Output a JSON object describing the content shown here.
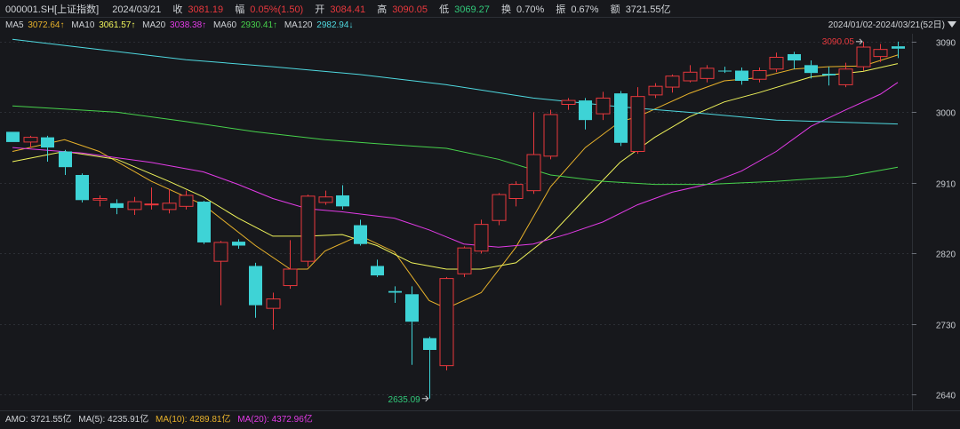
{
  "quote": {
    "symbol": "000001.SH[上证指数]",
    "date": "2024/03/21",
    "close_label": "收",
    "close": "3081.19",
    "change_label": "幅",
    "change": "0.05%(1.50)",
    "open_label": "开",
    "open": "3084.41",
    "high_label": "高",
    "high": "3090.05",
    "low_label": "低",
    "low": "3069.27",
    "turnover_label": "换",
    "turnover": "0.70%",
    "amplitude_label": "振",
    "amplitude": "0.67%",
    "amount_label": "额",
    "amount": "3721.55亿"
  },
  "ma_bar": [
    {
      "label": "MA5",
      "value": "3072.64↑",
      "color": "#e8b22b"
    },
    {
      "label": "MA10",
      "value": "3061.57↑",
      "color": "#eef25a"
    },
    {
      "label": "MA20",
      "value": "3038.38↑",
      "color": "#e23be6"
    },
    {
      "label": "MA60",
      "value": "2930.41↑",
      "color": "#47d24c"
    },
    {
      "label": "MA120",
      "value": "2982.94↓",
      "color": "#4fd9e0"
    }
  ],
  "range_label": "2024/01/02-2024/03/21(52日)",
  "range_icon": "triangle-down-icon",
  "annotations": {
    "high": "3090.05",
    "low": "2635.09"
  },
  "amo_bar": {
    "label": "AMO: ",
    "value": "3721.55亿",
    "items": [
      {
        "text": "MA(5): 4235.91亿",
        "color": "#cfd2d6"
      },
      {
        "text": "MA(10): 4289.81亿",
        "color": "#e8b22b"
      },
      {
        "text": "MA(20): 4372.96亿",
        "color": "#e23be6"
      }
    ]
  },
  "colors": {
    "up": "#e8383d",
    "down": "#3ed3d6",
    "grid": "#2c2f35",
    "text": "#c8cbd0",
    "bg": "#17181c"
  },
  "chart_data": {
    "type": "candlestick",
    "ylim": [
      2620,
      3100
    ],
    "yticks": [
      3090,
      3000,
      2910,
      2820,
      2730,
      2640
    ],
    "candles": [
      {
        "o": 2975,
        "c": 2962,
        "h": 2975,
        "l": 2962
      },
      {
        "o": 2962,
        "c": 2968,
        "h": 2970,
        "l": 2955
      },
      {
        "o": 2968,
        "c": 2955,
        "h": 2970,
        "l": 2937
      },
      {
        "o": 2950,
        "c": 2930,
        "h": 2952,
        "l": 2920
      },
      {
        "o": 2920,
        "c": 2888,
        "h": 2922,
        "l": 2885
      },
      {
        "o": 2888,
        "c": 2890,
        "h": 2894,
        "l": 2880
      },
      {
        "o": 2884,
        "c": 2878,
        "h": 2889,
        "l": 2870
      },
      {
        "o": 2876,
        "c": 2886,
        "h": 2892,
        "l": 2869
      },
      {
        "o": 2882,
        "c": 2883,
        "h": 2904,
        "l": 2876
      },
      {
        "o": 2876,
        "c": 2884,
        "h": 2902,
        "l": 2871
      },
      {
        "o": 2880,
        "c": 2894,
        "h": 2900,
        "l": 2876
      },
      {
        "o": 2886,
        "c": 2834,
        "h": 2887,
        "l": 2832
      },
      {
        "o": 2810,
        "c": 2834,
        "h": 2836,
        "l": 2754
      },
      {
        "o": 2835,
        "c": 2830,
        "h": 2838,
        "l": 2826
      },
      {
        "o": 2804,
        "c": 2754,
        "h": 2808,
        "l": 2738
      },
      {
        "o": 2750,
        "c": 2762,
        "h": 2770,
        "l": 2723
      },
      {
        "o": 2779,
        "c": 2800,
        "h": 2837,
        "l": 2775
      },
      {
        "o": 2810,
        "c": 2893,
        "h": 2895,
        "l": 2803
      },
      {
        "o": 2885,
        "c": 2892,
        "h": 2900,
        "l": 2882
      },
      {
        "o": 2894,
        "c": 2880,
        "h": 2907,
        "l": 2876
      },
      {
        "o": 2856,
        "c": 2832,
        "h": 2863,
        "l": 2830
      },
      {
        "o": 2804,
        "c": 2792,
        "h": 2812,
        "l": 2790
      },
      {
        "o": 2772,
        "c": 2770,
        "h": 2778,
        "l": 2757
      },
      {
        "o": 2768,
        "c": 2733,
        "h": 2778,
        "l": 2678
      },
      {
        "o": 2712,
        "c": 2697,
        "h": 2714,
        "l": 2635
      },
      {
        "o": 2677,
        "c": 2788,
        "h": 2790,
        "l": 2671
      },
      {
        "o": 2794,
        "c": 2827,
        "h": 2829,
        "l": 2790
      },
      {
        "o": 2823,
        "c": 2857,
        "h": 2863,
        "l": 2820
      },
      {
        "o": 2862,
        "c": 2895,
        "h": 2897,
        "l": 2856
      },
      {
        "o": 2890,
        "c": 2908,
        "h": 2912,
        "l": 2880
      },
      {
        "o": 2900,
        "c": 2946,
        "h": 3000,
        "l": 2896
      },
      {
        "o": 2944,
        "c": 2997,
        "h": 3003,
        "l": 2940
      },
      {
        "o": 3010,
        "c": 3015,
        "h": 3018,
        "l": 3003
      },
      {
        "o": 3015,
        "c": 2990,
        "h": 3018,
        "l": 2978
      },
      {
        "o": 2998,
        "c": 3018,
        "h": 3026,
        "l": 2990
      },
      {
        "o": 3024,
        "c": 2961,
        "h": 3027,
        "l": 2957
      },
      {
        "o": 2950,
        "c": 3020,
        "h": 3032,
        "l": 2947
      },
      {
        "o": 3022,
        "c": 3033,
        "h": 3037,
        "l": 3018
      },
      {
        "o": 3032,
        "c": 3046,
        "h": 3048,
        "l": 3025
      },
      {
        "o": 3040,
        "c": 3051,
        "h": 3060,
        "l": 3038
      },
      {
        "o": 3043,
        "c": 3056,
        "h": 3060,
        "l": 3038
      },
      {
        "o": 3053,
        "c": 3052,
        "h": 3058,
        "l": 3050
      },
      {
        "o": 3053,
        "c": 3040,
        "h": 3057,
        "l": 3035
      },
      {
        "o": 3042,
        "c": 3053,
        "h": 3057,
        "l": 3038
      },
      {
        "o": 3055,
        "c": 3070,
        "h": 3076,
        "l": 3051
      },
      {
        "o": 3074,
        "c": 3066,
        "h": 3077,
        "l": 3055
      },
      {
        "o": 3060,
        "c": 3050,
        "h": 3066,
        "l": 3043
      },
      {
        "o": 3049,
        "c": 3047,
        "h": 3058,
        "l": 3034
      },
      {
        "o": 3035,
        "c": 3055,
        "h": 3063,
        "l": 3032
      },
      {
        "o": 3058,
        "c": 3083,
        "h": 3090,
        "l": 3053
      },
      {
        "o": 3071,
        "c": 3080,
        "h": 3087,
        "l": 3064
      },
      {
        "o": 3084,
        "c": 3081,
        "h": 3090,
        "l": 3069
      }
    ],
    "ma": [
      {
        "name": "MA5",
        "color": "#e8b22b",
        "points": [
          [
            0,
            2950
          ],
          [
            3,
            2965
          ],
          [
            5,
            2950
          ],
          [
            8,
            2912
          ],
          [
            11,
            2882
          ],
          [
            14,
            2830
          ],
          [
            16,
            2800
          ],
          [
            17,
            2800
          ],
          [
            18,
            2823
          ],
          [
            20,
            2843
          ],
          [
            22,
            2822
          ],
          [
            24,
            2760
          ],
          [
            25,
            2750
          ],
          [
            27,
            2770
          ],
          [
            29,
            2828
          ],
          [
            31,
            2905
          ],
          [
            33,
            2955
          ],
          [
            35,
            2988
          ],
          [
            36,
            2994
          ],
          [
            37,
            3004
          ],
          [
            39,
            3024
          ],
          [
            41,
            3040
          ],
          [
            43,
            3044
          ],
          [
            45,
            3055
          ],
          [
            47,
            3058
          ],
          [
            49,
            3059
          ],
          [
            51,
            3073
          ]
        ]
      },
      {
        "name": "MA10",
        "color": "#eef25a",
        "points": [
          [
            0,
            2937
          ],
          [
            3,
            2950
          ],
          [
            6,
            2940
          ],
          [
            9,
            2912
          ],
          [
            11,
            2892
          ],
          [
            13,
            2865
          ],
          [
            15,
            2842
          ],
          [
            17,
            2842
          ],
          [
            19,
            2844
          ],
          [
            21,
            2830
          ],
          [
            23,
            2808
          ],
          [
            25,
            2800
          ],
          [
            27,
            2800
          ],
          [
            29,
            2808
          ],
          [
            31,
            2843
          ],
          [
            33,
            2890
          ],
          [
            35,
            2936
          ],
          [
            37,
            2968
          ],
          [
            39,
            2994
          ],
          [
            41,
            3013
          ],
          [
            43,
            3025
          ],
          [
            46,
            3045
          ],
          [
            49,
            3052
          ],
          [
            51,
            3062
          ]
        ]
      },
      {
        "name": "MA20",
        "color": "#e23be6",
        "points": [
          [
            0,
            2955
          ],
          [
            4,
            2948
          ],
          [
            8,
            2936
          ],
          [
            11,
            2924
          ],
          [
            13,
            2908
          ],
          [
            15,
            2890
          ],
          [
            17,
            2877
          ],
          [
            19,
            2873
          ],
          [
            22,
            2865
          ],
          [
            24,
            2850
          ],
          [
            26,
            2832
          ],
          [
            28,
            2828
          ],
          [
            30,
            2832
          ],
          [
            32,
            2845
          ],
          [
            34,
            2860
          ],
          [
            36,
            2882
          ],
          [
            38,
            2898
          ],
          [
            40,
            2908
          ],
          [
            42,
            2925
          ],
          [
            44,
            2950
          ],
          [
            46,
            2982
          ],
          [
            48,
            3003
          ],
          [
            50,
            3023
          ],
          [
            51,
            3038
          ]
        ]
      },
      {
        "name": "MA60",
        "color": "#47d24c",
        "points": [
          [
            0,
            3008
          ],
          [
            6,
            3000
          ],
          [
            10,
            2988
          ],
          [
            14,
            2975
          ],
          [
            18,
            2965
          ],
          [
            21,
            2960
          ],
          [
            25,
            2954
          ],
          [
            28,
            2940
          ],
          [
            31,
            2920
          ],
          [
            34,
            2912
          ],
          [
            37,
            2908
          ],
          [
            40,
            2908
          ],
          [
            44,
            2912
          ],
          [
            48,
            2918
          ],
          [
            51,
            2930
          ]
        ]
      },
      {
        "name": "MA120",
        "color": "#4fd9e0",
        "points": [
          [
            0,
            3093
          ],
          [
            5,
            3080
          ],
          [
            10,
            3067
          ],
          [
            15,
            3058
          ],
          [
            20,
            3048
          ],
          [
            25,
            3035
          ],
          [
            30,
            3018
          ],
          [
            35,
            3007
          ],
          [
            40,
            2998
          ],
          [
            44,
            2990
          ],
          [
            48,
            2987
          ],
          [
            51,
            2985
          ]
        ]
      }
    ]
  }
}
